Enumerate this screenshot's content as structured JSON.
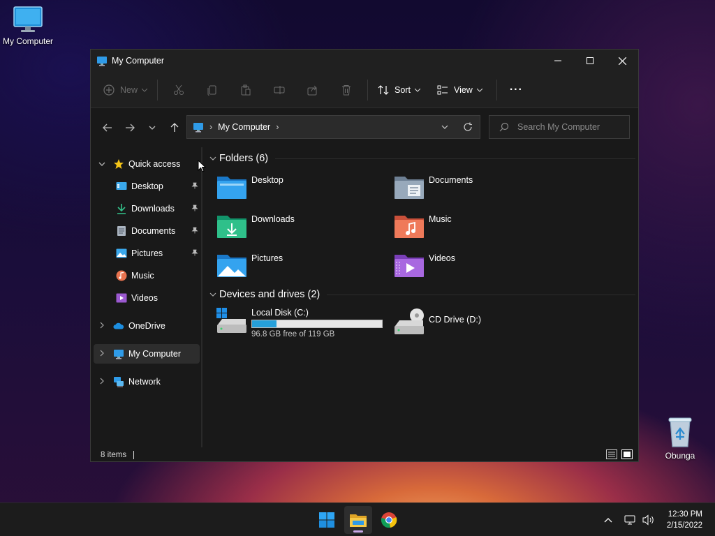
{
  "desktop": {
    "my_computer_label": "My Computer",
    "recycle_bin_label": "Obunga"
  },
  "window": {
    "title": "My Computer",
    "controls": {
      "minimize": "—",
      "maximize": "☐",
      "close": "✕"
    }
  },
  "toolbar": {
    "new_label": "New",
    "sort_label": "Sort",
    "view_label": "View",
    "more_label": "···"
  },
  "address": {
    "path": "My Computer",
    "separator": "›"
  },
  "search": {
    "placeholder": "Search My Computer"
  },
  "sidebar": {
    "quick_access": "Quick access",
    "items": [
      {
        "label": "Desktop",
        "icon": "desktop-icon",
        "pinned": true
      },
      {
        "label": "Downloads",
        "icon": "download-icon",
        "pinned": true
      },
      {
        "label": "Documents",
        "icon": "document-icon",
        "pinned": true
      },
      {
        "label": "Pictures",
        "icon": "pictures-icon",
        "pinned": true
      },
      {
        "label": "Music",
        "icon": "music-icon",
        "pinned": false
      },
      {
        "label": "Videos",
        "icon": "videos-icon",
        "pinned": false
      }
    ],
    "onedrive": "OneDrive",
    "my_computer": "My Computer",
    "network": "Network"
  },
  "content": {
    "folders_heading": "Folders (6)",
    "folders": [
      "Desktop",
      "Documents",
      "Downloads",
      "Music",
      "Pictures",
      "Videos"
    ],
    "drives_heading": "Devices and drives (2)",
    "drives": [
      {
        "name": "Local Disk (C:)",
        "free": "96.8 GB free of 119 GB",
        "used_fraction": 0.187
      },
      {
        "name": "CD Drive (D:)"
      }
    ]
  },
  "status": {
    "items": "8 items"
  },
  "taskbar": {
    "time": "12:30 PM",
    "date": "2/15/2022"
  },
  "colors": {
    "accent": "#26a0da",
    "folder_blue": "#2f9be8",
    "star": "#f5c518"
  }
}
